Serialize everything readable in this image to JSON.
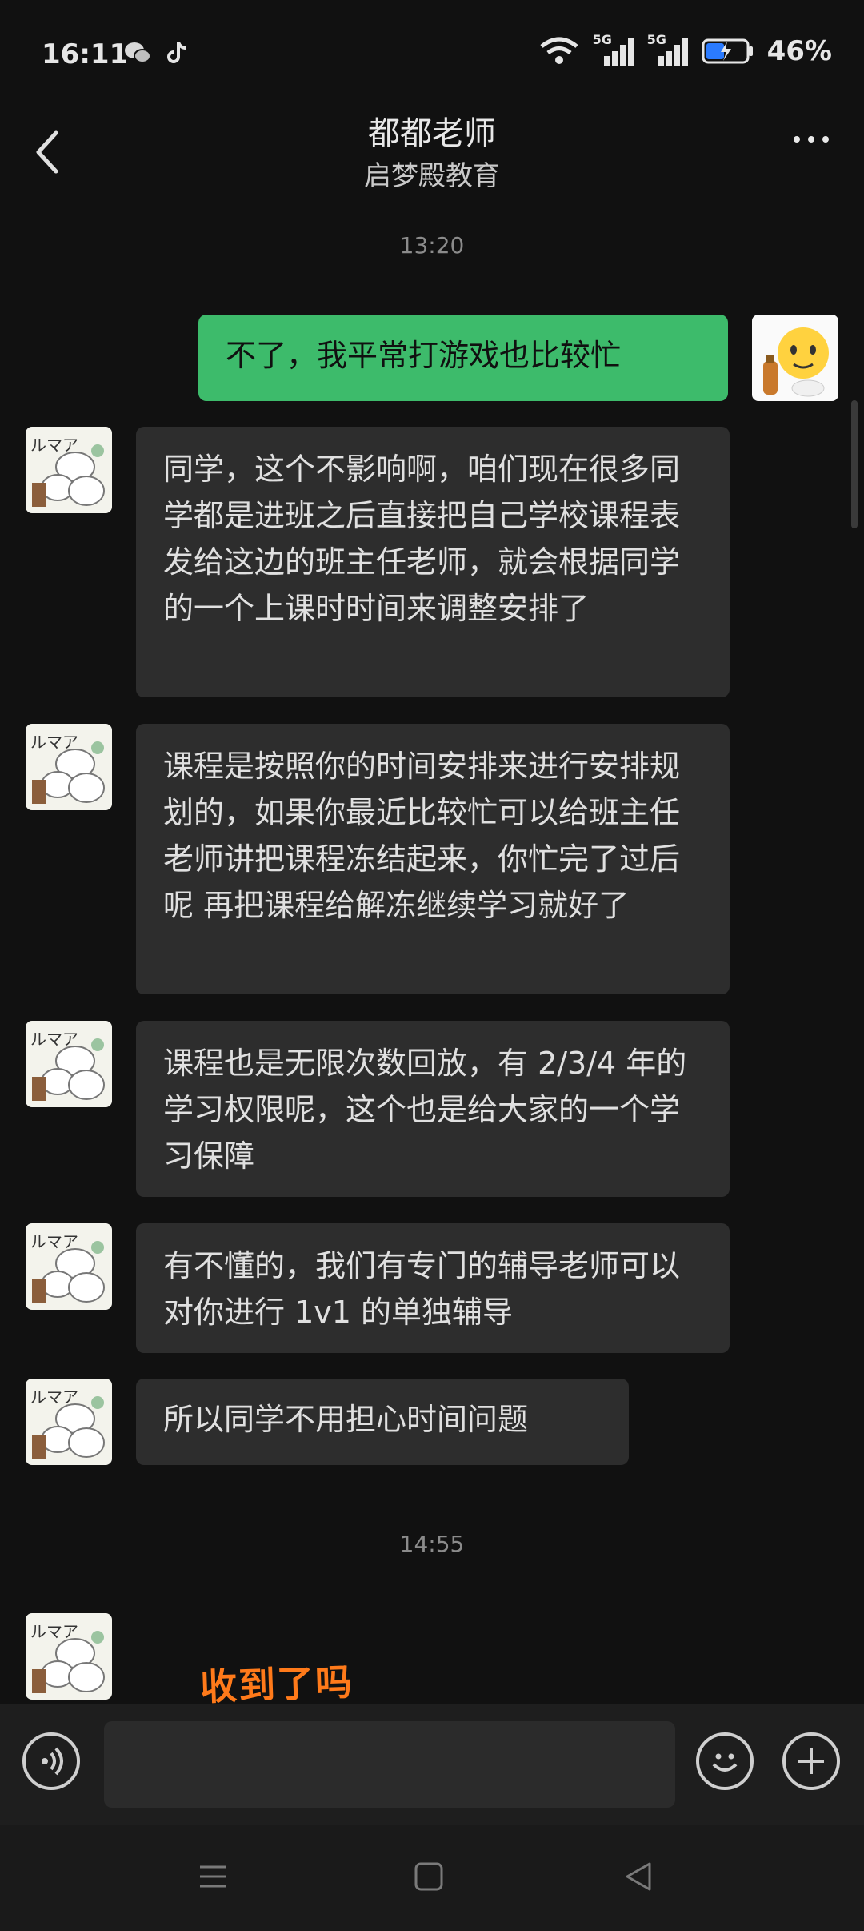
{
  "status": {
    "time": "16:11",
    "battery": "46%",
    "network1": "5G",
    "network2": "5G",
    "app_icons": [
      "wechat-icon",
      "tiktok-icon"
    ]
  },
  "header": {
    "title": "都都老师",
    "subtitle": "启梦殿教育"
  },
  "timestamps": [
    "13:20",
    "14:55"
  ],
  "messages": [
    {
      "from": "self",
      "text": "不了，我平常打游戏也比较忙"
    },
    {
      "from": "other",
      "text": "同学，这个不影响啊，咱们现在很多同学都是进班之后直接把自己学校课程表发给这边的班主任老师，就会根据同学的一个上课时时间来调整安排了"
    },
    {
      "from": "other",
      "text": "课程是按照你的时间安排来进行安排规划的，如果你最近比较忙可以给班主任老师讲把课程冻结起来，你忙完了过后呢 再把课程给解冻继续学习就好了"
    },
    {
      "from": "other",
      "text": "课程也是无限次数回放，有 2/3/4 年的学习权限呢，这个也是给大家的一个学习保障"
    },
    {
      "from": "other",
      "text": "有不懂的，我们有专门的辅导老师可以对你进行 1v1 的单独辅导"
    },
    {
      "from": "other",
      "text": "所以同学不用担心时间问题"
    }
  ],
  "sticker": {
    "text": "收到了吗"
  },
  "avatar_text": "ルマア",
  "input": {
    "placeholder": ""
  },
  "colors": {
    "background": "#111111",
    "bubble_in": "#2d2d2d",
    "bubble_out": "#3dbb6b",
    "sticker": "#ff7a1a"
  }
}
